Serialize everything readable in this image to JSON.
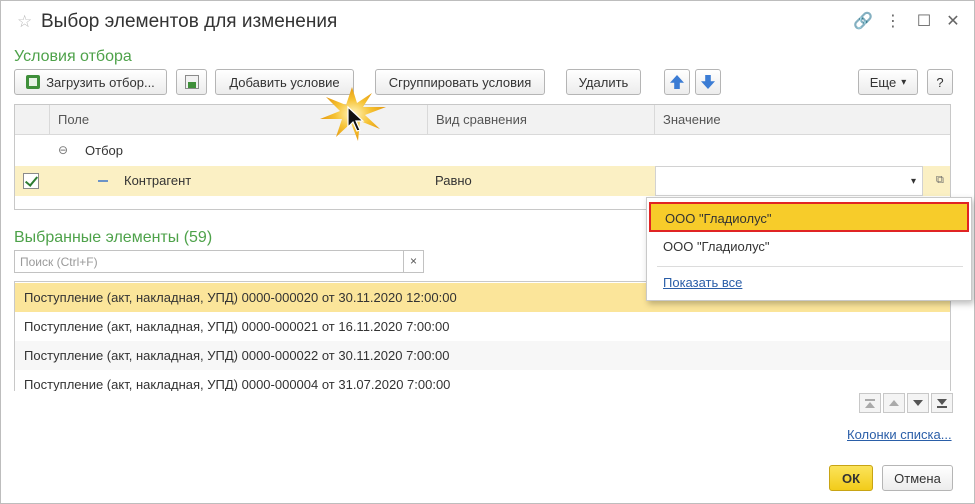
{
  "window": {
    "title": "Выбор элементов для изменения",
    "icons": [
      "star-icon",
      "link-icon",
      "more-icon",
      "maximize-icon",
      "close-icon"
    ],
    "controls": {
      "link": "🔗",
      "more": "⋮",
      "maximize": "☐",
      "close": "✕",
      "star": "☆"
    }
  },
  "filter": {
    "section_title": "Условия отбора",
    "toolbar": {
      "load_filter": "Загрузить отбор...",
      "add_condition": "Добавить условие",
      "group_conditions": "Сгруппировать условия",
      "delete": "Удалить",
      "more": "Еще",
      "more_arrow": "▾",
      "help": "?"
    },
    "columns": {
      "field": "Поле",
      "comparison": "Вид сравнения",
      "value": "Значение"
    },
    "group_row": {
      "toggle": "⊖",
      "label": "Отбор"
    },
    "condition_row": {
      "checked": true,
      "field": "Контрагент",
      "comparison": "Равно",
      "value": "",
      "dropdown_arrow": "▾",
      "open_icon": "⧉"
    },
    "dropdown": {
      "items": [
        "ООО \"Гладиолус\"",
        "ООО \"Гладиолус\""
      ],
      "selected_index": 0,
      "show_all": "Показать все"
    }
  },
  "selected": {
    "section_title": "Выбранные элементы (59)",
    "search": {
      "placeholder": "Поиск (Ctrl+F)",
      "value": "",
      "clear": "×"
    },
    "rows": [
      "Поступление (акт, накладная, УПД) 0000-000020 от 30.11.2020 12:00:00",
      "Поступление (акт, накладная, УПД) 0000-000021 от 16.11.2020 7:00:00",
      "Поступление (акт, накладная, УПД) 0000-000022 от 30.11.2020 7:00:00",
      "Поступление (акт, накладная, УПД) 0000-000004 от 31.07.2020 7:00:00"
    ],
    "list_columns_link": "Колонки списка..."
  },
  "footer": {
    "ok": "ОК",
    "cancel": "Отмена"
  },
  "colors": {
    "accent_green": "#4ea24a",
    "selected_row": "#fbe59a",
    "dropdown_selected": "#f7cc2a",
    "dropdown_border": "#e02424",
    "ok_button": "#f5d42a",
    "link": "#2a5ea8"
  }
}
